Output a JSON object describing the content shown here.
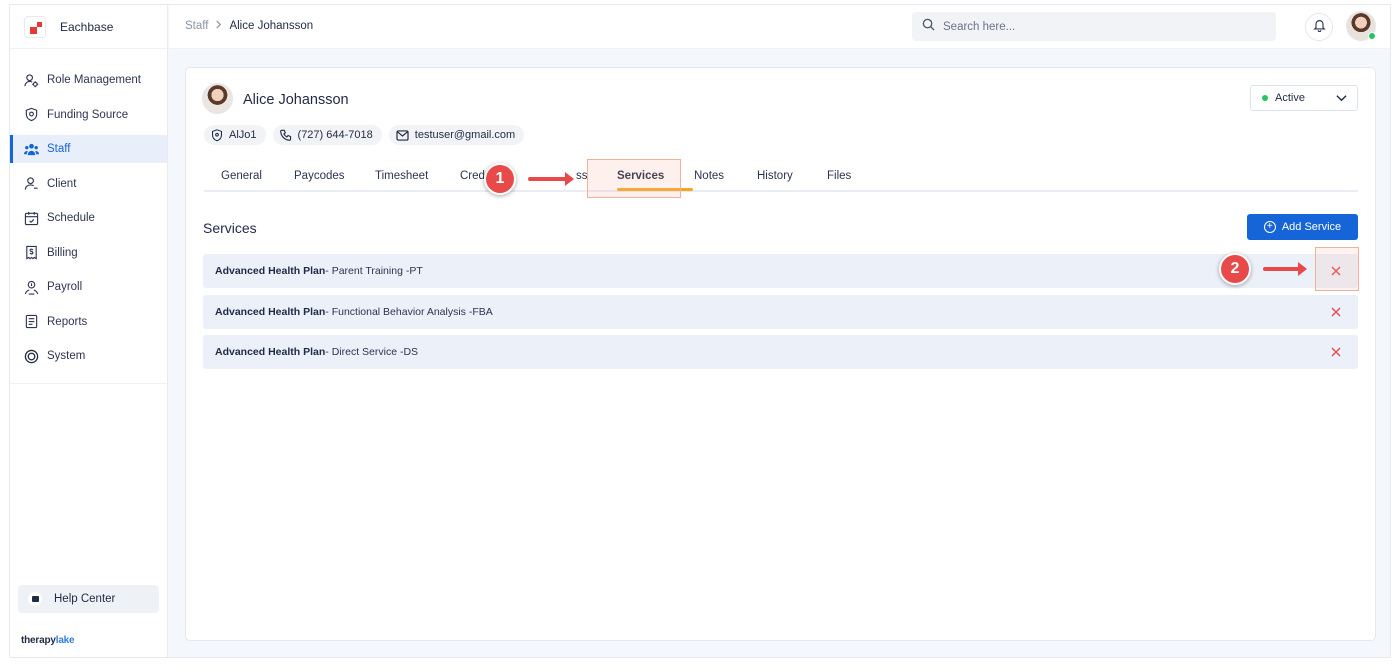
{
  "brand": {
    "name": "Eachbase",
    "footer_a": "therapy",
    "footer_b": "lake"
  },
  "sidebar": {
    "items": [
      {
        "label": "Role Management",
        "icon": "user-gear-icon"
      },
      {
        "label": "Funding Source",
        "icon": "shield-icon"
      },
      {
        "label": "Staff",
        "icon": "users-icon",
        "active": true
      },
      {
        "label": "Client",
        "icon": "user-icon"
      },
      {
        "label": "Schedule",
        "icon": "calendar-icon"
      },
      {
        "label": "Billing",
        "icon": "receipt-icon"
      },
      {
        "label": "Payroll",
        "icon": "payroll-icon"
      },
      {
        "label": "Reports",
        "icon": "report-icon"
      },
      {
        "label": "System",
        "icon": "system-icon"
      }
    ],
    "help": "Help Center"
  },
  "topbar": {
    "breadcrumb": {
      "parent": "Staff",
      "current": "Alice Johansson"
    },
    "search_placeholder": "Search here..."
  },
  "profile": {
    "name": "Alice Johansson",
    "status": "Active",
    "status_color": "#22c55e",
    "chips": {
      "id": "AlJo1",
      "phone": "(727) 644-7018",
      "email": "testuser@gmail.com"
    }
  },
  "tabs": {
    "general": "General",
    "paycodes": "Paycodes",
    "timesheet": "Timesheet",
    "cred": "Cred",
    "access_tail": "ss",
    "services": "Services",
    "notes": "Notes",
    "history": "History",
    "files": "Files",
    "active": "Services"
  },
  "services": {
    "title": "Services",
    "add_label": "Add Service",
    "rows": [
      {
        "plan": "Advanced Health Plan",
        "detail": " - Parent Training -PT"
      },
      {
        "plan": "Advanced Health Plan",
        "detail": " - Functional Behavior Analysis -FBA"
      },
      {
        "plan": "Advanced Health Plan",
        "detail": " - Direct Service -DS"
      }
    ]
  },
  "annotations": {
    "step1": "1",
    "step2": "2"
  },
  "colors": {
    "accent": "#1565d8",
    "delete": "#e84a4a",
    "tab_underline": "#f6a623"
  }
}
